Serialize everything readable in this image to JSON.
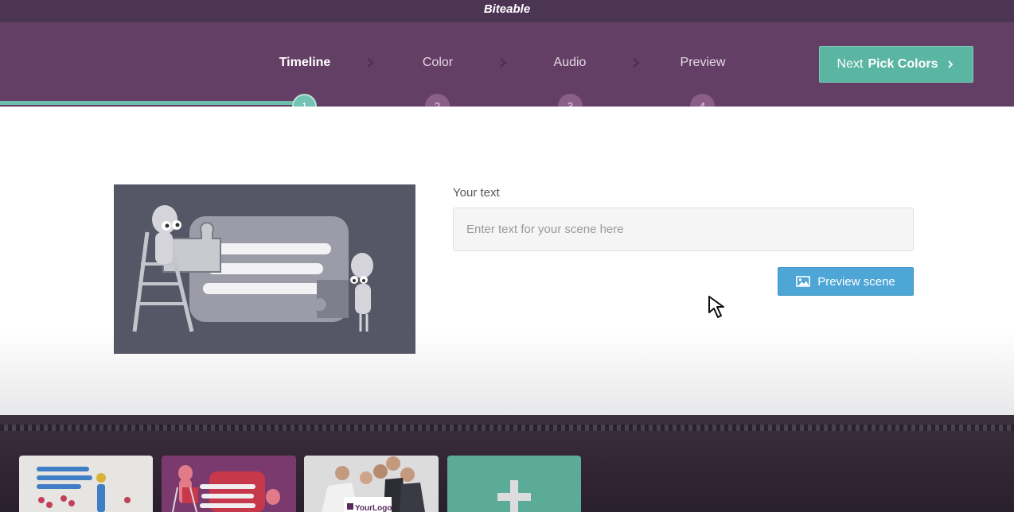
{
  "app": {
    "title": "Biteable"
  },
  "steps": [
    {
      "label": "Timeline",
      "number": "1",
      "active": true
    },
    {
      "label": "Color",
      "number": "2",
      "active": false
    },
    {
      "label": "Audio",
      "number": "3",
      "active": false
    },
    {
      "label": "Preview",
      "number": "4",
      "active": false
    }
  ],
  "next_button": {
    "prefix": "Next",
    "label": "Pick Colors",
    "icon": "chevron-right-icon"
  },
  "editor": {
    "text_label": "Your text",
    "text_value": "",
    "text_placeholder": "Enter text for your scene here",
    "preview_label": "Preview scene",
    "preview_icon": "image-icon"
  },
  "timeline": {
    "thumbnails": [
      {
        "name": "scene-thumb-1"
      },
      {
        "name": "scene-thumb-2"
      },
      {
        "name": "scene-thumb-3",
        "logo_text": "YourLogo"
      }
    ],
    "add_icon": "plus-icon"
  },
  "colors": {
    "brand_bar": "#4c3553",
    "step_bar": "#633f65",
    "accent_teal": "#5bb5a3",
    "preview_blue": "#4ea6d6",
    "step_inactive": "#8a5e88"
  }
}
